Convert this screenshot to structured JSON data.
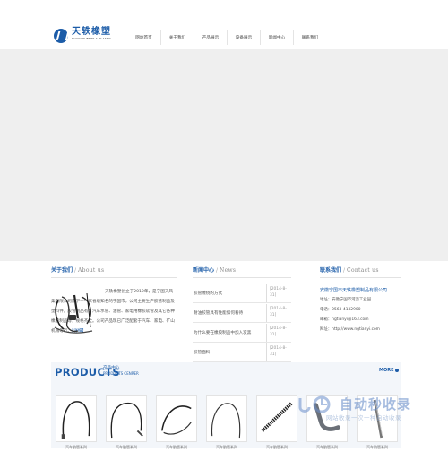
{
  "brand": {
    "name_cn": "天轶橡塑",
    "name_en": "TIANYI RUBBER & PLASTIC"
  },
  "nav": {
    "items": [
      "网站首页",
      "关于我们",
      "产品展示",
      "设备展示",
      "新闻中心",
      "联系我们"
    ]
  },
  "about": {
    "title_cn": "关于我们",
    "title_en": "About us",
    "text": "天轶橡塑创立于2010年，是宁国天风集有限公司旗下—一家省级知名的宁国市，公司主要生产胶管制品及塑料件，胶管制品有：汽车水管、油管、家电用橡胶软管及其它各种橡胶制品等，规格齐全。公司产品现已广泛配套于汽车、家电、矿山机械等行。",
    "more": "【详细】"
  },
  "news": {
    "title_cn": "新闻中心",
    "title_en": "News",
    "items": [
      {
        "title": "胶管缠绕的方式",
        "date_a": "[2014-8-",
        "date_b": "31]"
      },
      {
        "title": "耐油胶管具有性能如何看待",
        "date_a": "[2014-8-",
        "date_b": "31]"
      },
      {
        "title": "为什么要在橡胶制品中加入炭黑",
        "date_a": "[2014-8-",
        "date_b": "31]"
      },
      {
        "title": "胶管面料",
        "date_a": "[2014-8-",
        "date_b": "31]"
      }
    ]
  },
  "contact": {
    "title_cn": "联系我们",
    "title_en": "Contact us",
    "company": "安徽宁国市天轶橡塑制品有限公司",
    "lines": [
      "地址：安徽宁国市河沥工业园",
      "电话：0563-4132900",
      "邮箱：ngtianyi@163.com",
      "网址：http://www.ngtianyi.com"
    ]
  },
  "products": {
    "title_en": "PRODUCTS",
    "title_cn": "产品中心",
    "subtitle_en": "PRODUCTS CENRER",
    "more": "MORE",
    "items": [
      {
        "caption": "汽车胶管系列",
        "icon": "hose-loop-icon"
      },
      {
        "caption": "汽车胶管系列",
        "icon": "hose-bend-icon"
      },
      {
        "caption": "汽车胶管系列",
        "icon": "hose-curve-icon"
      },
      {
        "caption": "汽车胶管系列",
        "icon": "hose-arc-icon"
      },
      {
        "caption": "汽车胶管系列",
        "icon": "corrugated-tube-icon"
      },
      {
        "caption": "汽车胶管系列",
        "icon": "elbow-hose-icon"
      },
      {
        "caption": "汽车胶管系列",
        "icon": "straight-tube-icon"
      }
    ]
  },
  "watermark": {
    "main": "自动秒收录",
    "sub": "网站收录一次一种自动收录"
  },
  "colors": {
    "brand_blue": "#1c5ca8",
    "banner_gray": "#efefef",
    "products_bg": "#f3f6fa"
  }
}
